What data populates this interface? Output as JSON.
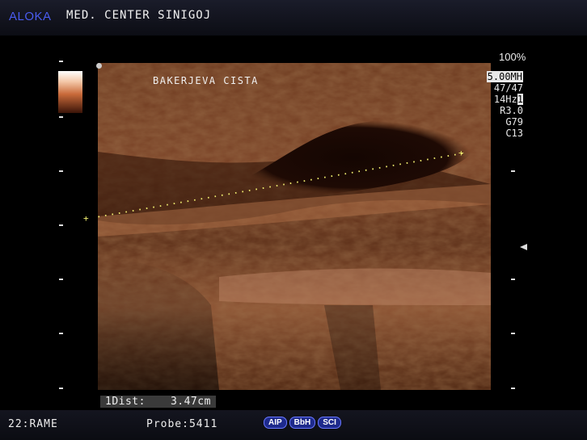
{
  "header": {
    "brand": "ALOKA",
    "center_name": "MED. CENTER SINIGOJ"
  },
  "image": {
    "annotation": "BAKERJEVA CISTA",
    "power": "100%"
  },
  "parameters": {
    "frequency": "5.00MH",
    "frame": "47/47",
    "rate": "14Hz",
    "rate_suffix": "1",
    "r": "R3.0",
    "gain": "G79",
    "contrast": "C13"
  },
  "measurement": {
    "label": "1Dist:",
    "value": "3.47cm"
  },
  "footer": {
    "preset": "22:RAME",
    "probe": "Probe:5411",
    "modes": [
      "AIP",
      "BbH",
      "SCI"
    ]
  },
  "colors": {
    "brand": "#4a5cf0",
    "tissue": "#8a4a28",
    "mode_button": "#1e2a8c"
  }
}
